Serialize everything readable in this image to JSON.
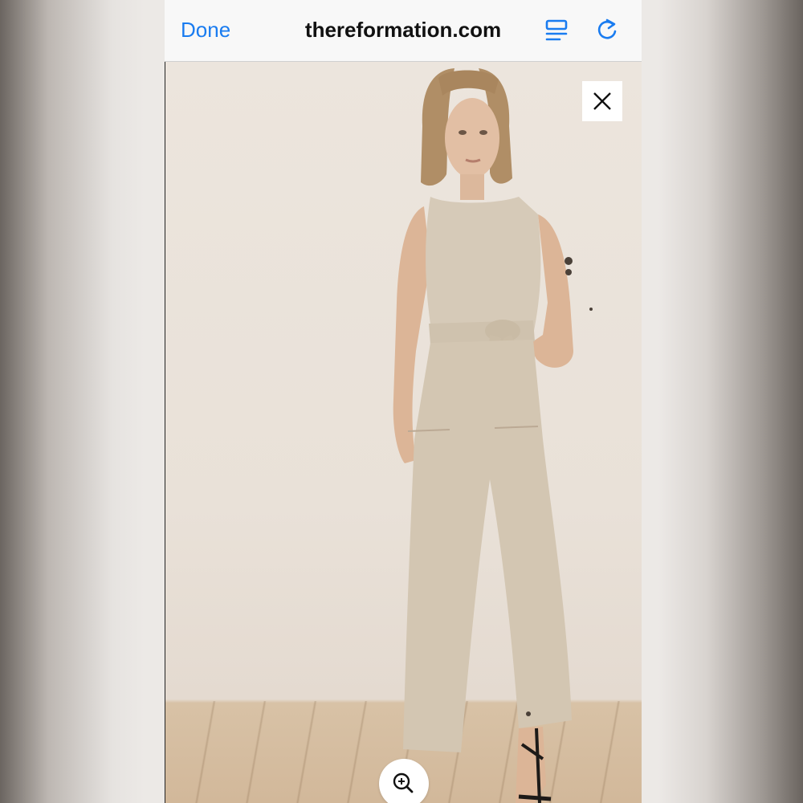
{
  "browser": {
    "done_label": "Done",
    "url": "thereformation.com",
    "reader_icon": "reader-mode-icon",
    "reload_icon": "reload-icon",
    "accent_color": "#1a7cf0"
  },
  "viewer": {
    "image_alt": "Model wearing a sleeveless linen jumpsuit with tie belt",
    "close_icon": "close-icon",
    "zoom_icon": "zoom-in-icon"
  }
}
